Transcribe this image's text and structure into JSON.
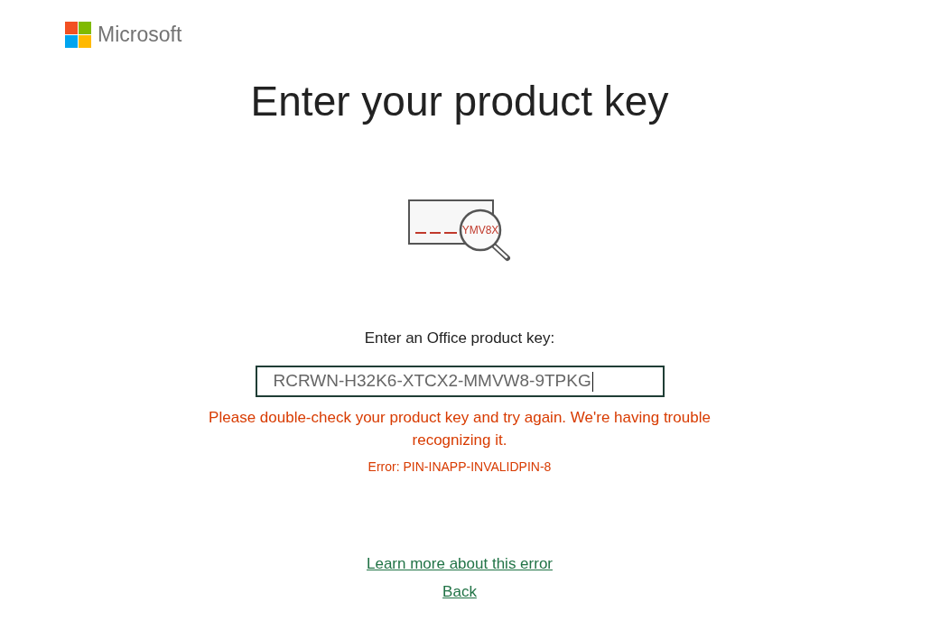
{
  "header": {
    "brand": "Microsoft"
  },
  "title": "Enter your product key",
  "illustration": {
    "key_fragment": "YMV8X"
  },
  "form": {
    "label": "Enter an Office product key:",
    "product_key_field": {
      "value": "RCRWN-H32K6-XTCX2-MMVW8-9TPKG",
      "focused": true
    }
  },
  "error": {
    "message": "Please double-check your product key and try again. We're having trouble recognizing it.",
    "code": "Error: PIN-INAPP-INVALIDPIN-8"
  },
  "links": [
    "Learn more about this error",
    "Back"
  ]
}
